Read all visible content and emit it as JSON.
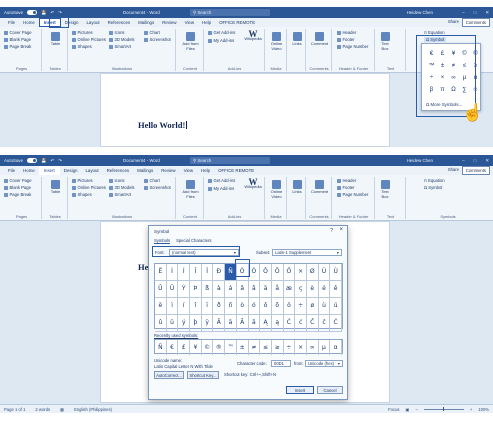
{
  "screen1": {
    "titlebar": {
      "autosave": "AutoSave",
      "toggle_state": "Off",
      "doc_title": "Document4 - Word",
      "search": "Search",
      "user": "Heidew Chen"
    },
    "tabs": [
      "File",
      "Home",
      "Insert",
      "Design",
      "Layout",
      "References",
      "Mailings",
      "Review",
      "View",
      "Help",
      "OFFICE REMOTE"
    ],
    "active_tab": "Insert",
    "share": "Share",
    "comments": "Comments",
    "ribbon": {
      "pages": {
        "items": [
          "Cover Page",
          "Blank Page",
          "Page Break"
        ],
        "label": "Pages"
      },
      "tables": {
        "button": "Table",
        "label": "Tables"
      },
      "illustrations": {
        "items": [
          "Pictures",
          "Online Pictures",
          "Shapes",
          "Icons",
          "3D Models",
          "SmartArt",
          "Chart",
          "Screenshot"
        ],
        "label": "Illustrations"
      },
      "content": {
        "button": "Add from Files",
        "label": "Content"
      },
      "addins": {
        "items": [
          "Get Add-ins",
          "My Add-ins"
        ],
        "wikipedia": "Wikipedia",
        "label": "Add-ins"
      },
      "media": {
        "button": "Online Video",
        "label": "Media"
      },
      "links": {
        "button": "Links",
        "label": ""
      },
      "comments": {
        "button": "Comment",
        "label": "Comments"
      },
      "header_footer": {
        "items": [
          "Header",
          "Footer",
          "Page Number"
        ],
        "label": "Header & Footer"
      },
      "text": {
        "button": "Text Box",
        "label": "Text"
      },
      "symbols": {
        "equation": "Equation",
        "symbol": "Symbol",
        "label": "Symbols"
      }
    },
    "document_text": "Hello World!",
    "symbol_dropdown": {
      "symbols": [
        "€",
        "£",
        "¥",
        "©",
        "®",
        "™",
        "±",
        "≠",
        "≤",
        "≥",
        "÷",
        "×",
        "∞",
        "µ",
        "α",
        "β",
        "π",
        "Ω",
        "∑",
        "☺"
      ],
      "more": "More Symbols..."
    }
  },
  "screen2": {
    "titlebar": {
      "autosave": "AutoSave",
      "toggle_state": "Off",
      "doc_title": "Document4 - Word",
      "search": "Search",
      "user": "Heidew Chen"
    },
    "tabs": [
      "File",
      "Home",
      "Insert",
      "Design",
      "Layout",
      "References",
      "Mailings",
      "Review",
      "View",
      "Help",
      "OFFICE REMOTE"
    ],
    "active_tab": "Insert",
    "share": "Share",
    "comments": "Comments",
    "document_text": "Hello World!",
    "dialog": {
      "title": "Symbol",
      "help": "?",
      "tabs": [
        "Symbols",
        "Special Characters"
      ],
      "font_label": "Font:",
      "font_value": "(normal text)",
      "subset_label": "Subset:",
      "subset_value": "Latin-1 Supplement",
      "chars": [
        "Ë",
        "Ì",
        "Í",
        "Î",
        "Ï",
        "Ð",
        "Ñ",
        "Ò",
        "Ó",
        "Ô",
        "Õ",
        "Ö",
        "×",
        "Ø",
        "Ù",
        "Ú",
        "Û",
        "Ü",
        "Ý",
        "Þ",
        "ß",
        "à",
        "á",
        "â",
        "ã",
        "ä",
        "å",
        "æ",
        "ç",
        "è",
        "é",
        "ê",
        "ë",
        "ì",
        "í",
        "î",
        "ï",
        "ð",
        "ñ",
        "ò",
        "ó",
        "ô",
        "õ",
        "ö",
        "÷",
        "ø",
        "ù",
        "ú",
        "û",
        "ü",
        "ý",
        "þ",
        "ÿ",
        "Ā",
        "ā",
        "Ă",
        "ă",
        "Ą",
        "ą",
        "Ć",
        "ć",
        "Ĉ",
        "ĉ",
        "Ċ"
      ],
      "selected_index": 6,
      "recent_label": "Recently used symbols:",
      "recent": [
        "Ñ",
        "€",
        "£",
        "¥",
        "©",
        "®",
        "™",
        "±",
        "≠",
        "≤",
        "≥",
        "÷",
        "×",
        "∞",
        "µ",
        "α"
      ],
      "unicode_name_label": "Unicode name:",
      "unicode_name": "Latin Capital Letter N With Tilde",
      "char_code_label": "Character code:",
      "char_code": "00D1",
      "from_label": "from:",
      "from_value": "Unicode (hex)",
      "autocorrect": "AutoCorrect...",
      "shortcut_key_btn": "Shortcut Key...",
      "shortcut_text": "Shortcut key: Ctrl+~,Shift+N",
      "insert": "Insert",
      "cancel": "Cancel"
    },
    "statusbar": {
      "page": "Page 1 of 1",
      "words": "2 words",
      "language": "English (Philippines)",
      "focus": "Focus",
      "zoom": "100%"
    }
  }
}
